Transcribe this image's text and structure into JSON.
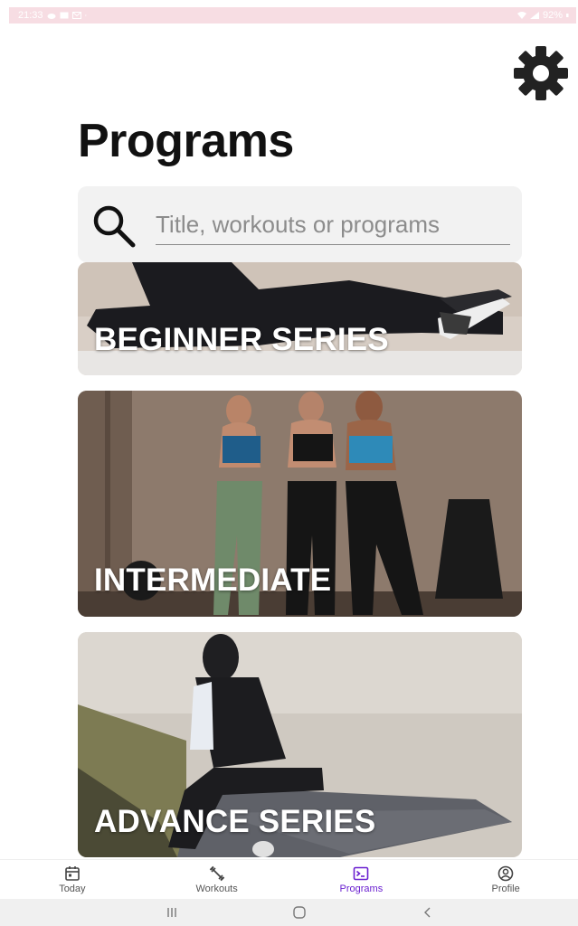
{
  "status_bar": {
    "time": "21:33",
    "battery": "92%"
  },
  "header": {
    "title": "Programs",
    "settings_icon": "gear-icon"
  },
  "search": {
    "placeholder": "Title, workouts or programs",
    "icon": "search-icon"
  },
  "programs": [
    {
      "label": "BEGINNER SERIES"
    },
    {
      "label": "INTERMEDIATE"
    },
    {
      "label": "ADVANCE SERIES"
    }
  ],
  "bottom_nav": {
    "items": [
      {
        "label": "Today",
        "icon": "calendar-icon"
      },
      {
        "label": "Workouts",
        "icon": "dumbbell-icon"
      },
      {
        "label": "Programs",
        "icon": "terminal-icon",
        "active": true
      },
      {
        "label": "Profile",
        "icon": "profile-icon"
      }
    ],
    "active_color": "#6a1fd0"
  },
  "system_nav": {
    "recents_icon": "recents-icon",
    "home_icon": "home-icon",
    "back_icon": "back-icon"
  },
  "colors": {
    "status_bar_bg": "#f7dde3",
    "search_bg": "#f2f2f2",
    "title": "#111111"
  }
}
